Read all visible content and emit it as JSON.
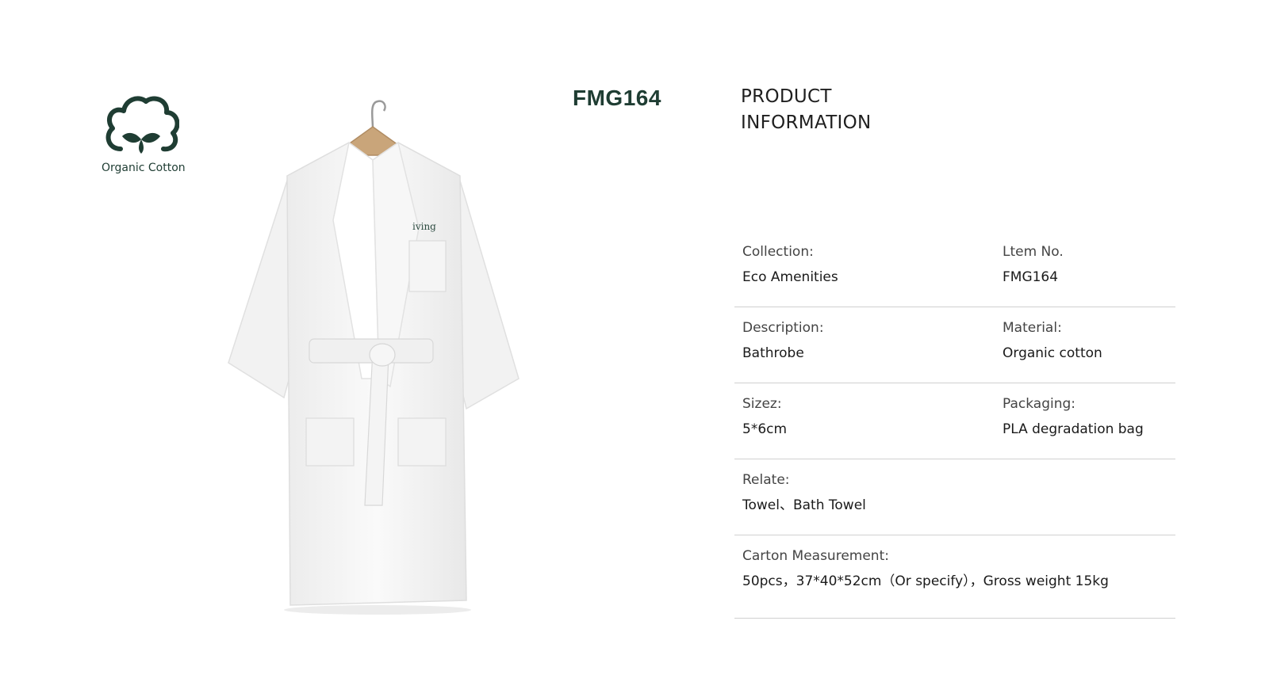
{
  "badge": {
    "icon": "cotton-boll-icon",
    "label": "Organic Cotton",
    "color": "#1f3d33"
  },
  "product": {
    "sku": "FMG164",
    "image_alt": "White bathrobe on wooden hanger",
    "embroidery_text": "iving"
  },
  "section": {
    "title_line1": "PRODUCT",
    "title_line2": "INFORMATION"
  },
  "info": {
    "collection": {
      "label": "Collection:",
      "value": "Eco Amenities"
    },
    "item_no": {
      "label": "Ltem No.",
      "value": "FMG164"
    },
    "description": {
      "label": "Description:",
      "value": "Bathrobe"
    },
    "material": {
      "label": "Material:",
      "value": "Organic cotton"
    },
    "size": {
      "label": "Sizez:",
      "value": "5*6cm"
    },
    "packaging": {
      "label": "Packaging:",
      "value": "PLA degradation bag"
    },
    "relate": {
      "label": "Relate:",
      "value": "Towel、Bath Towel"
    },
    "carton": {
      "label": "Carton Measurement:",
      "value": "50pcs，37*40*52cm（Or specify），Gross weight 15kg"
    }
  }
}
